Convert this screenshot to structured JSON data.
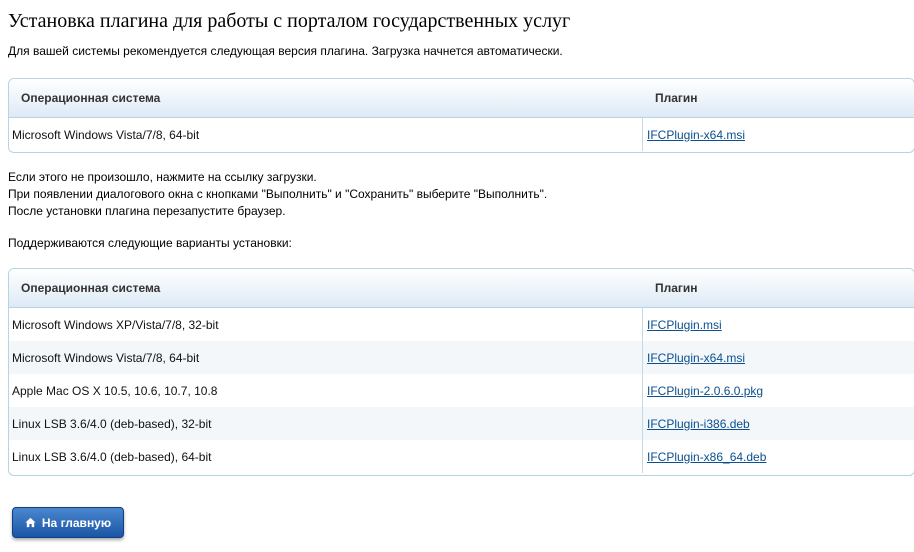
{
  "header": {
    "title": "Установка плагина для работы с порталом государственных услуг"
  },
  "intro": "Для вашей системы рекомендуется следующая версия плагина. Загрузка начнется автоматически.",
  "recommended_table": {
    "columns": [
      "Операционная система",
      "Плагин"
    ],
    "rows": [
      {
        "os": "Microsoft Windows Vista/7/8, 64-bit",
        "plugin": "IFCPlugin-x64.msi"
      }
    ]
  },
  "notes": {
    "line1": "Если этого не произошло, нажмите на ссылку загрузки.",
    "line2": "При появлении диалогового окна с кнопками \"Выполнить\" и \"Сохранить\" выберите \"Выполнить\".",
    "line3": "После установки плагина перезапустите браузер."
  },
  "supported_heading": "Поддерживаются следующие варианты установки:",
  "supported_table": {
    "columns": [
      "Операционная система",
      "Плагин"
    ],
    "rows": [
      {
        "os": "Microsoft Windows XP/Vista/7/8, 32-bit",
        "plugin": "IFCPlugin.msi"
      },
      {
        "os": "Microsoft Windows Vista/7/8, 64-bit",
        "plugin": "IFCPlugin-x64.msi"
      },
      {
        "os": "Apple Mac OS X 10.5, 10.6, 10.7, 10.8",
        "plugin": "IFCPlugin-2.0.6.0.pkg"
      },
      {
        "os": "Linux LSB 3.6/4.0 (deb-based), 32-bit",
        "plugin": "IFCPlugin-i386.deb"
      },
      {
        "os": "Linux LSB 3.6/4.0 (deb-based), 64-bit",
        "plugin": "IFCPlugin-x86_64.deb"
      }
    ]
  },
  "home_button": {
    "label": "На главную",
    "icon": "home-icon"
  },
  "colors": {
    "link": "#0a4f8f",
    "button": "#1b55a6",
    "table_border": "#b7d3e6"
  }
}
